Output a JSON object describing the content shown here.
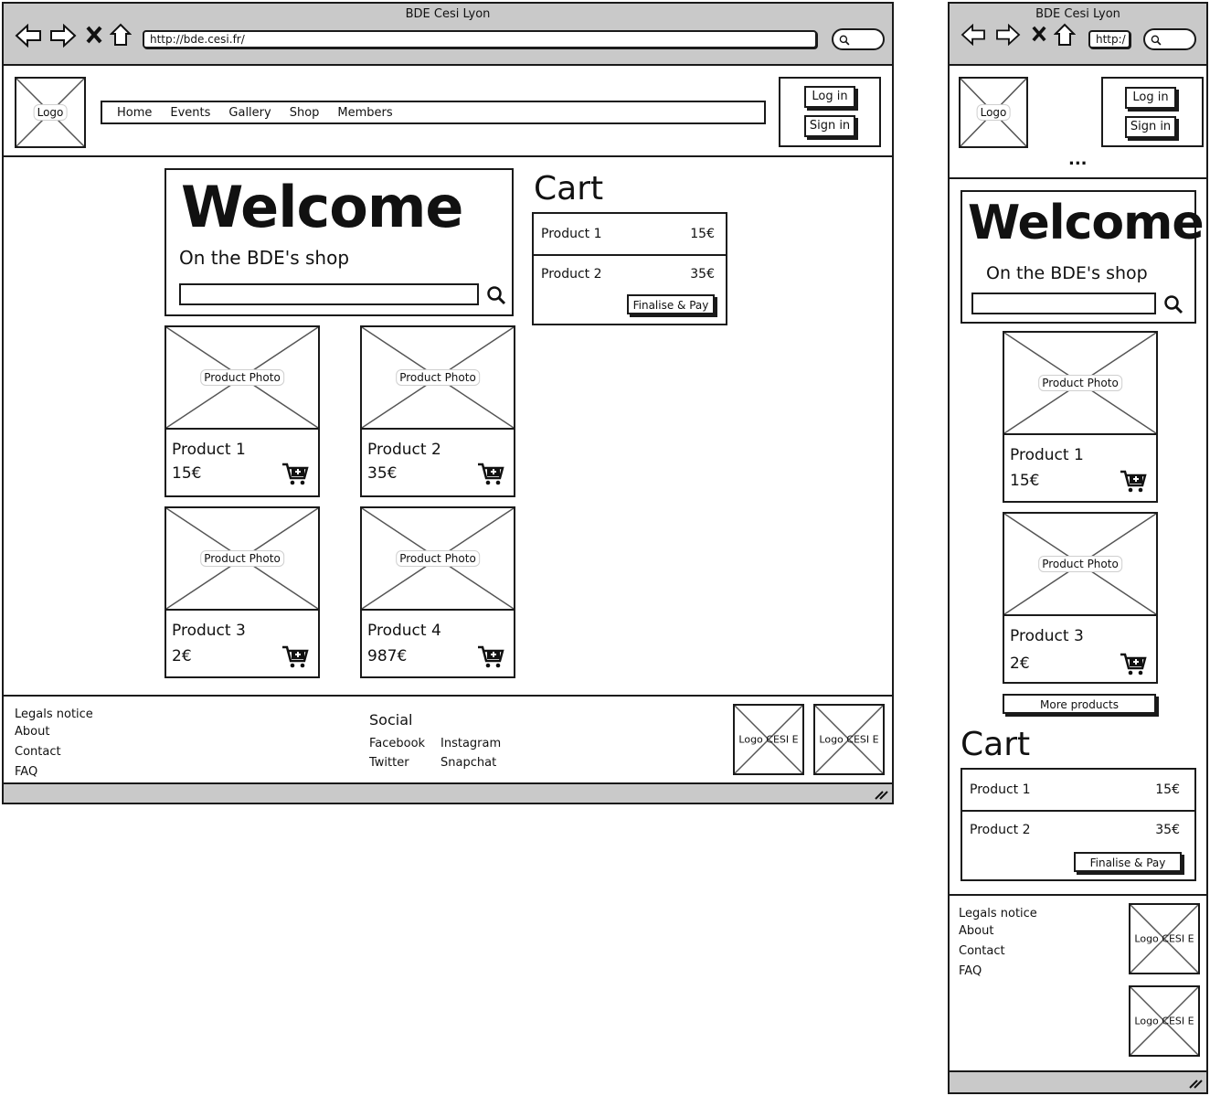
{
  "browser": {
    "title": "BDE Cesi Lyon",
    "url": "http://bde.cesi.fr/",
    "url_mobile": "http:/"
  },
  "header": {
    "logo": "Logo",
    "nav": [
      "Home",
      "Events",
      "Gallery",
      "Shop",
      "Members"
    ],
    "login": "Log in",
    "signin": "Sign in",
    "more": "..."
  },
  "hero": {
    "title": "Welcome",
    "subtitle": "On the BDE's shop"
  },
  "products": [
    {
      "name": "Product 1",
      "price": "15€",
      "photo": "Product Photo"
    },
    {
      "name": "Product 2",
      "price": "35€",
      "photo": "Product Photo"
    },
    {
      "name": "Product 3",
      "price": "2€",
      "photo": "Product Photo"
    },
    {
      "name": "Product 4",
      "price": "987€",
      "photo": "Product Photo"
    }
  ],
  "cart": {
    "title": "Cart",
    "items": [
      {
        "name": "Product 1",
        "price": "15€"
      },
      {
        "name": "Product 2",
        "price": "35€"
      }
    ],
    "pay": "Finalise & Pay"
  },
  "more_products": "More products",
  "footer": {
    "links": [
      "Legals notice",
      "About",
      "Contact",
      "FAQ"
    ],
    "social_title": "Social",
    "social": [
      "Facebook",
      "Instagram",
      "Twitter",
      "Snapchat"
    ],
    "partner_logo": "Logo CESI E"
  },
  "icons": [
    "back-icon",
    "forward-icon",
    "close-icon",
    "home-icon",
    "search-icon",
    "add-to-cart-icon",
    "resize-icon"
  ]
}
